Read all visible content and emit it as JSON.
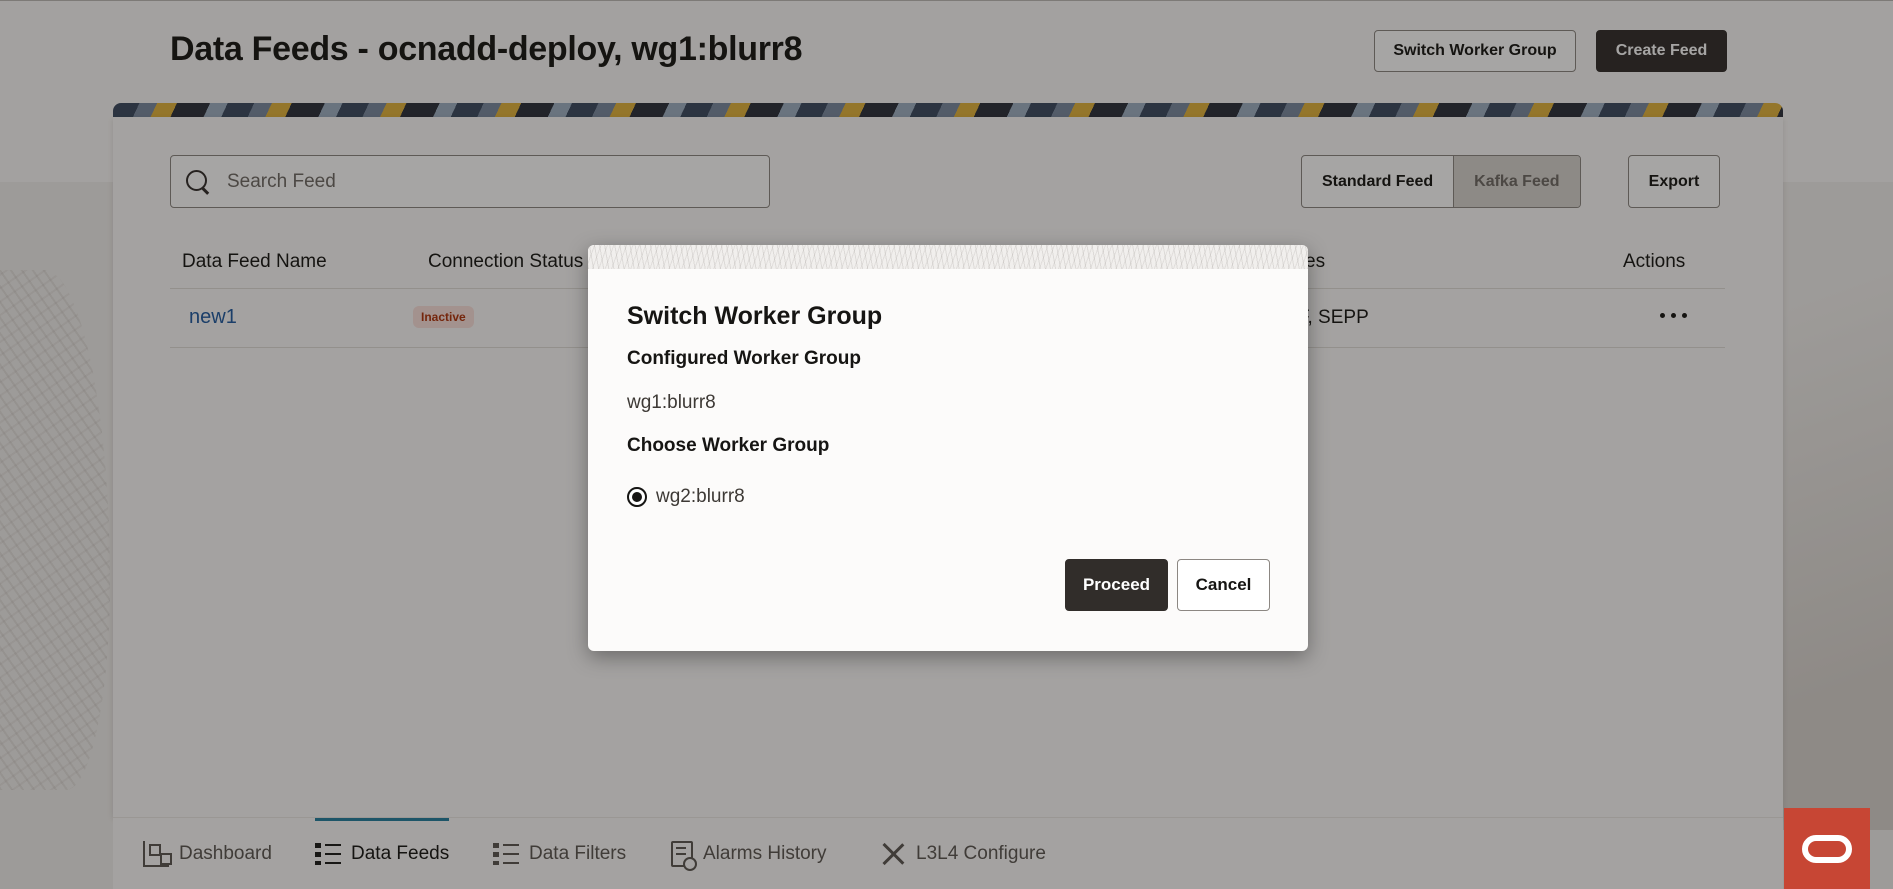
{
  "header": {
    "title": "Data Feeds - ocnadd-deploy, wg1:blurr8",
    "switch_worker_group_label": "Switch Worker Group",
    "create_feed_label": "Create Feed"
  },
  "toolbar": {
    "search_placeholder": "Search Feed",
    "feed_types": [
      "Standard Feed",
      "Kafka Feed"
    ],
    "selected_feed_type": "Kafka Feed",
    "export_label": "Export"
  },
  "table": {
    "columns": {
      "name": "Data Feed Name",
      "status": "Connection Status",
      "sources_partial": "es",
      "actions": "Actions"
    },
    "rows": [
      {
        "name": "new1",
        "status": "Inactive",
        "sources_partial": "F, SEPP"
      }
    ]
  },
  "bottom_nav": {
    "items": [
      {
        "label": "Dashboard",
        "icon": "dashboard-icon"
      },
      {
        "label": "Data Feeds",
        "icon": "list-icon"
      },
      {
        "label": "Data Filters",
        "icon": "list-icon"
      },
      {
        "label": "Alarms History",
        "icon": "alarm-history-icon"
      },
      {
        "label": "L3L4 Configure",
        "icon": "tools-icon"
      }
    ],
    "active": "Data Feeds"
  },
  "dialog": {
    "title": "Switch Worker Group",
    "configured_label": "Configured Worker Group",
    "configured_value": "wg1:blurr8",
    "choose_label": "Choose Worker Group",
    "options": [
      "wg2:blurr8"
    ],
    "selected_option": "wg2:blurr8",
    "proceed_label": "Proceed",
    "cancel_label": "Cancel"
  },
  "colors": {
    "accent": "#227e9e",
    "brand": "#c74634",
    "inactive_badge_text": "#b0320a",
    "inactive_badge_bg": "#fbe0dc",
    "link": "#1f5aa0"
  }
}
